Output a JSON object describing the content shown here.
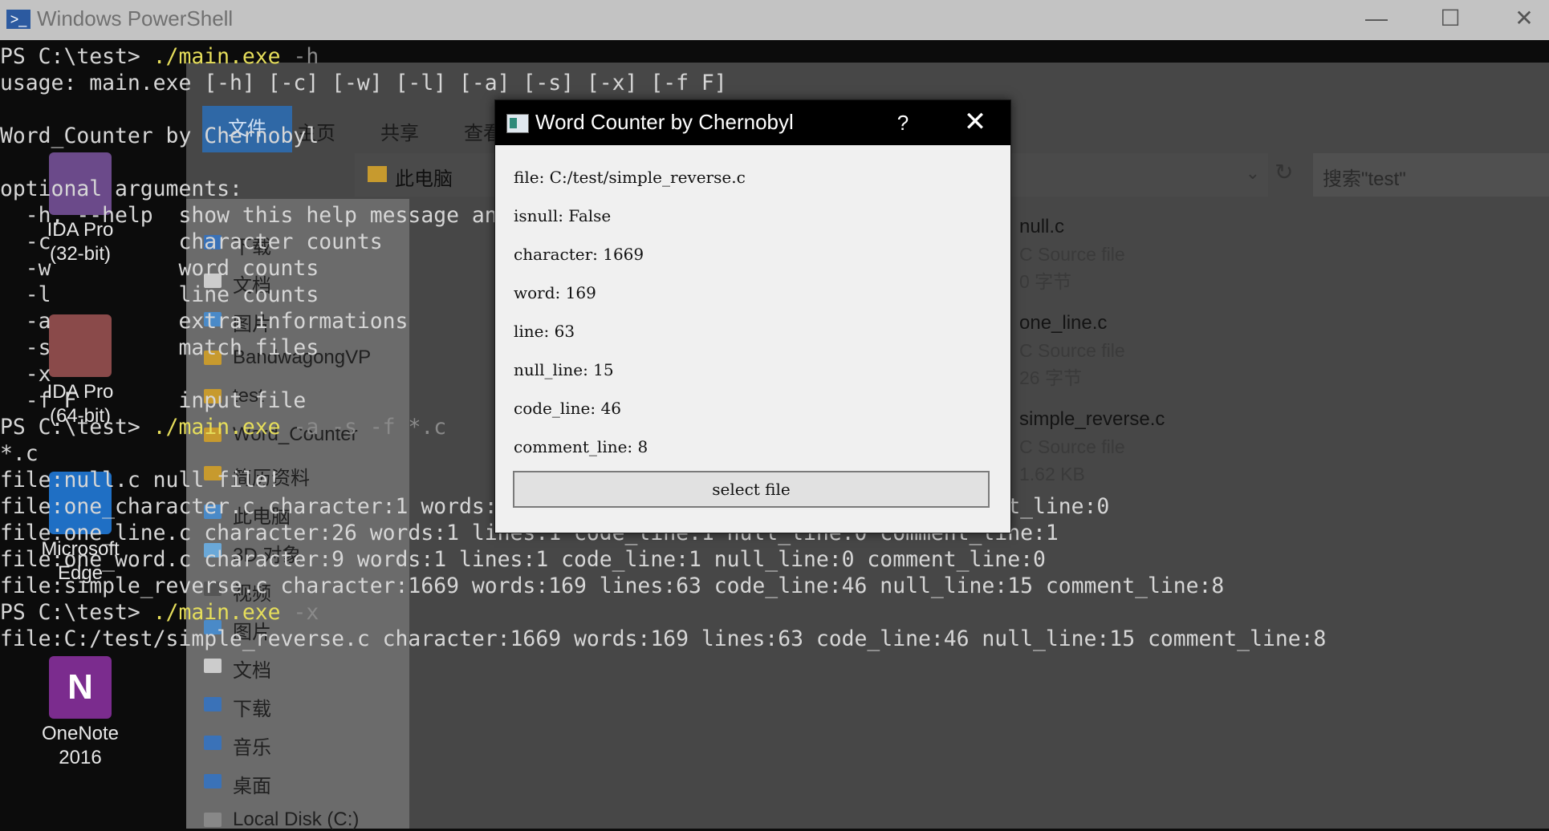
{
  "powershell": {
    "title": "Windows PowerShell",
    "window_buttons": {
      "minimize": "—",
      "maximize": "☐",
      "close": "✕"
    }
  },
  "terminal": {
    "lines": [
      {
        "prompt": "PS C:\\test> ",
        "cmd": "./main.exe",
        "rest": " -h"
      },
      {
        "text": "usage: main.exe [-h] [-c] [-w] [-l] [-a] [-s] [-x] [-f F]"
      },
      {
        "text": ""
      },
      {
        "text": "Word_Counter by Chernobyl"
      },
      {
        "text": ""
      },
      {
        "text": "optional arguments:"
      },
      {
        "text": "  -h, --help  show this help message and exit"
      },
      {
        "text": "  -c          character counts"
      },
      {
        "text": "  -w          word counts"
      },
      {
        "text": "  -l          line counts"
      },
      {
        "text": "  -a          extra informations"
      },
      {
        "text": "  -s          match files"
      },
      {
        "text": "  -x          "
      },
      {
        "text": "  -f F        input file"
      },
      {
        "prompt": "PS C:\\test> ",
        "cmd": "./main.exe",
        "rest": " -a -s -f *.c"
      },
      {
        "text": "*.c"
      },
      {
        "text": "file:null.c null file!"
      },
      {
        "text": "file:one_character.c character:1 words:1 lines:1 code_line:1 null_line:0 comment_line:0"
      },
      {
        "text": "file:one_line.c character:26 words:1 lines:1 code_line:1 null_line:0 comment_line:1"
      },
      {
        "text": "file:one_word.c character:9 words:1 lines:1 code_line:1 null_line:0 comment_line:0"
      },
      {
        "text": "file:simple_reverse.c character:1669 words:169 lines:63 code_line:46 null_line:15 comment_line:8"
      },
      {
        "prompt": "PS C:\\test> ",
        "cmd": "./main.exe",
        "rest": " -x"
      },
      {
        "text": "file:C:/test/simple_reverse.c character:1669 words:169 lines:63 code_line:46 null_line:15 comment_line:8"
      }
    ]
  },
  "desktop_icons": [
    {
      "label1": "IDA Pro",
      "label2": "(32-bit)",
      "color": "#6b4a8a"
    },
    {
      "label1": "IDA Pro",
      "label2": "(64-bit)",
      "color": "#8a4a4a"
    },
    {
      "label1": "Microsoft",
      "label2": "Edge",
      "color": "#1f6fc4"
    },
    {
      "label1": "OneNote",
      "label2": "2016",
      "color": "#7b2c8e"
    }
  ],
  "explorer": {
    "ribbon_tabs": [
      "文件",
      "主页",
      "共享",
      "查看"
    ],
    "address_root": "此电脑",
    "search_placeholder": "搜索\"test\"",
    "nav_items": [
      "下载",
      "文档",
      "图片",
      "BandwagongVP",
      "test",
      "Word_Counter",
      "简历资料",
      "此电脑",
      "3D 对象",
      "视频",
      "图片",
      "文档",
      "下载",
      "音乐",
      "桌面",
      "Local Disk (C:)"
    ],
    "files": [
      {
        "name": "null.c",
        "type": "C Source file",
        "size": "0 字节"
      },
      {
        "name": "one_line.c",
        "type": "C Source file",
        "size": "26 字节"
      },
      {
        "name": "simple_reverse.c",
        "type": "C Source file",
        "size": "1.62 KB"
      }
    ]
  },
  "dialog": {
    "title": "Word Counter by Chernobyl",
    "help_label": "?",
    "close_label": "✕",
    "fields": [
      "file: C:/test/simple_reverse.c",
      "isnull: False",
      "character: 1669",
      "word: 169",
      "line: 63",
      "null_line: 15",
      "code_line: 46",
      "comment_line: 8"
    ],
    "select_button": "select file"
  }
}
